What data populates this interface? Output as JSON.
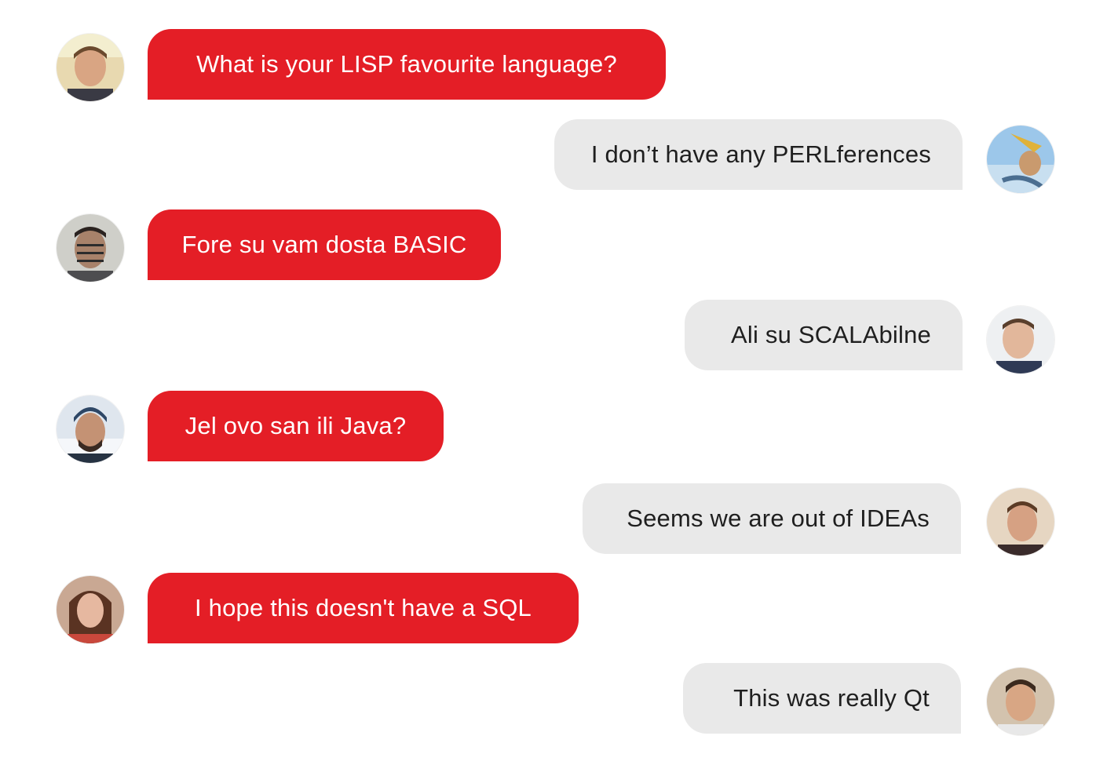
{
  "colors": {
    "sent_bubble": "#e41e26",
    "received_bubble": "#e9e9e9",
    "sent_text": "#ffffff",
    "received_text": "#1f1f1f"
  },
  "messages": [
    {
      "side": "left",
      "text": "What is your LISP favourite language?",
      "avatar": "user-avatar-1"
    },
    {
      "side": "right",
      "text": "I don’t have any PERLferences",
      "avatar": "user-avatar-2"
    },
    {
      "side": "left",
      "text": "Fore su vam dosta BASIC",
      "avatar": "user-avatar-3"
    },
    {
      "side": "right",
      "text": "Ali su SCALAbilne",
      "avatar": "user-avatar-4"
    },
    {
      "side": "left",
      "text": "Jel ovo san ili Java?",
      "avatar": "user-avatar-5"
    },
    {
      "side": "right",
      "text": "Seems we are out of IDEAs",
      "avatar": "user-avatar-6"
    },
    {
      "side": "left",
      "text": "I hope this doesn't have a SQL",
      "avatar": "user-avatar-7"
    },
    {
      "side": "right",
      "text": "This was really Qt",
      "avatar": "user-avatar-8"
    }
  ]
}
